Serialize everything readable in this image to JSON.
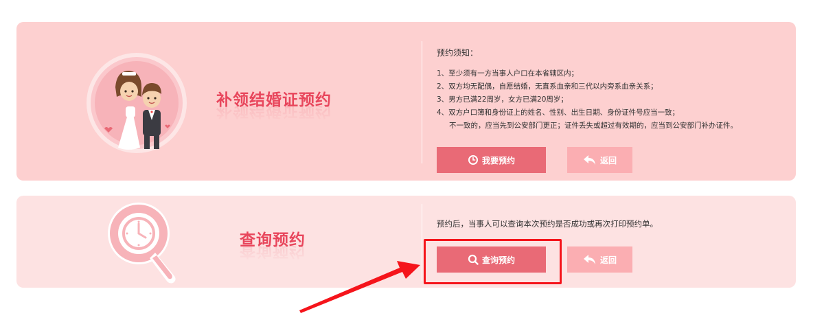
{
  "reissue": {
    "title": "补领结婚证预约",
    "notice_title": "预约须知：",
    "rules": [
      "1、至少须有一方当事人户口在本省辖区内；",
      "2、双方均无配偶，自愿结婚，无直系血亲和三代以内旁系血亲关系；",
      "3、男方已满22周岁，女方已满20周岁；",
      "4、双方户口簿和身份证上的姓名、性别、出生日期、身份证件号应当一致；",
      "不一致的，应当先到公安部门更正；证件丢失或超过有效期的，应当到公安部门补办证件。"
    ],
    "book_button": "我要预约",
    "back_button": "返回"
  },
  "query": {
    "title": "查询预约",
    "description": "预约后，当事人可以查询本次预约是否成功或再次打印预约单。",
    "query_button": "查询预约",
    "back_button": "返回"
  },
  "icons": {
    "couple": "bride-groom-icon",
    "search_clock": "magnifier-clock-icon",
    "clock": "clock-icon",
    "search": "search-icon",
    "back": "undo-arrow-icon"
  },
  "colors": {
    "panel1_bg": "#fdd0d0",
    "panel2_bg": "#fde2e2",
    "title": "#e8465c",
    "primary_button": "#e96a76",
    "back_button": "#fbaeb2",
    "annotation": "#f5141b"
  }
}
